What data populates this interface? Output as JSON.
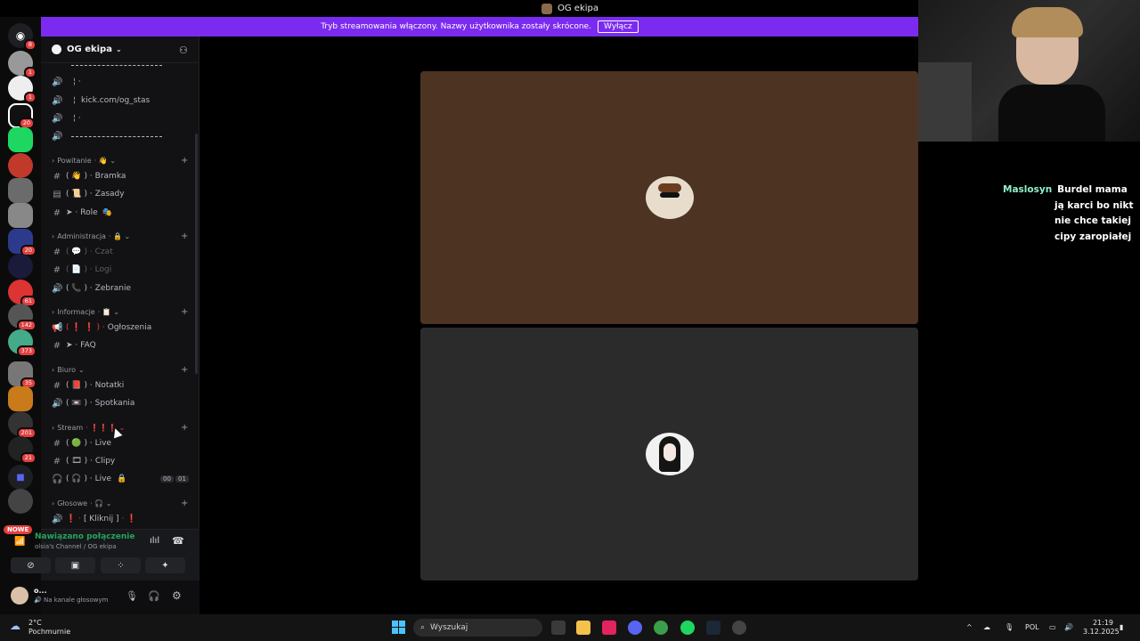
{
  "window": {
    "title": "OG ekipa"
  },
  "banner": {
    "text": "Tryb streamowania włączony. Nazwy użytkownika zostały skrócone.",
    "button": "Wyłącz",
    "color": "#7b2bf0"
  },
  "server_badges": [
    "8",
    "1",
    "1",
    "20",
    "",
    "",
    "",
    "",
    "",
    "20",
    "",
    "61",
    "142",
    "373",
    "35",
    "",
    "201",
    "21",
    "",
    ""
  ],
  "server_new_label": "NOWE",
  "server": {
    "name": "OG ekipa"
  },
  "channels_top": {
    "kick": "kick.com/og_stas"
  },
  "categories": {
    "powitanie": "Powitanie",
    "administracja": "Administracja",
    "informacje": "Informacje",
    "biuro": "Biuro",
    "stream": "Stream",
    "glosowe": "Głosowe"
  },
  "channels": {
    "bramka": "Bramka",
    "zasady": "Zasady",
    "role": "Role",
    "czat": "Czat",
    "logi": "Logi",
    "zebranie": "Zebranie",
    "ogloszenia": "Ogłoszenia",
    "faq": "FAQ",
    "notatki": "Notatki",
    "spotkania": "Spotkania",
    "live1": "Live",
    "clipy": "Clipy",
    "live2": "Live",
    "live2_counts": [
      "00",
      "01"
    ],
    "kliknij": "[ Kliknij ]"
  },
  "voice": {
    "status": "Nawiązano połączenie",
    "channel": "olsia's Channel / OG ekipa"
  },
  "user": {
    "name": "o...",
    "status": "Na kanale głosowym"
  },
  "chat": {
    "name": "Maslosyn",
    "message": "Burdel mama ją karci bo nikt nie chce takiej cipy zaropiałej"
  },
  "taskbar": {
    "weather_temp": "2°C",
    "weather_desc": "Pochmurnie",
    "search_placeholder": "Wyszukaj",
    "lang": "POL",
    "time": "21:19",
    "date": "3.12.2025"
  }
}
